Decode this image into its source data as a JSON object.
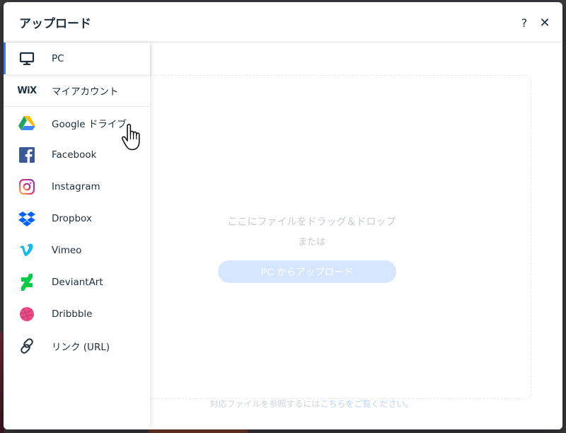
{
  "dialog": {
    "title": "アップロード",
    "help_label": "?",
    "close_label": "✕"
  },
  "sidebar": {
    "items": [
      {
        "label": "PC",
        "icon": "monitor-icon",
        "active": true
      },
      {
        "label": "マイアカウント",
        "icon": "wix-logo-icon",
        "logo_text": "WiX"
      },
      {
        "label": "Google ドライブ",
        "icon": "google-drive-icon",
        "hovered": true
      },
      {
        "label": "Facebook",
        "icon": "facebook-icon"
      },
      {
        "label": "Instagram",
        "icon": "instagram-icon"
      },
      {
        "label": "Dropbox",
        "icon": "dropbox-icon"
      },
      {
        "label": "Vimeo",
        "icon": "vimeo-icon"
      },
      {
        "label": "DeviantArt",
        "icon": "deviantart-icon"
      },
      {
        "label": "Dribbble",
        "icon": "dribbble-icon"
      },
      {
        "label": "リンク (URL)",
        "icon": "link-icon"
      }
    ]
  },
  "main": {
    "drop_text": "ここにファイルをドラッグ＆ドロップ",
    "or_text": "または",
    "upload_button": "PC からアップロード",
    "footer_prefix": "対応ファイルを参照するには",
    "footer_link": "こちらをご覧ください。"
  },
  "colors": {
    "accent": "#3b7bf0",
    "upload_button_bg": "#d6e6fe",
    "text": "#20303c",
    "muted_text": "#c5cbd3"
  }
}
